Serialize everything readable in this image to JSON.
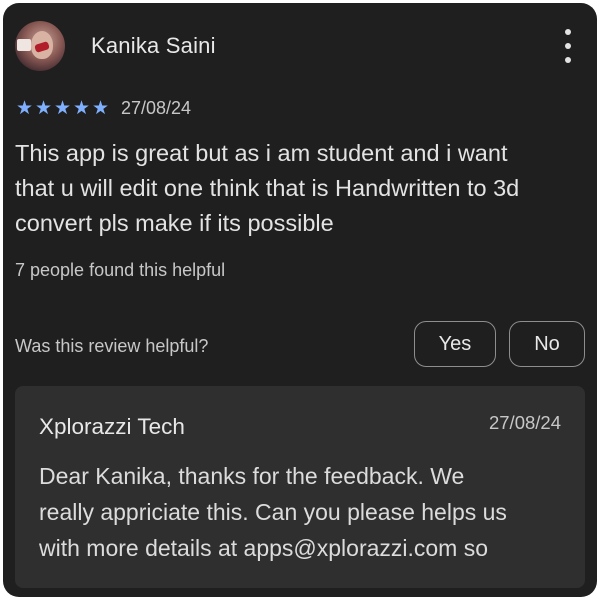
{
  "review": {
    "reviewer_name": "Kanika Saini",
    "avatar_icon": "user-avatar-photo",
    "more_icon": "more-vert-icon",
    "rating": 5,
    "rating_max": 5,
    "star_color": "#7fb0ff",
    "date": "27/08/24",
    "text_lines": [
      "This app is great but as i am student and i want",
      "that u will edit one think that is Handwritten to 3d",
      "convert pls make if its possible"
    ],
    "helpful_count_text": "7 people found this helpful"
  },
  "feedback": {
    "question": "Was this review helpful?",
    "yes_label": "Yes",
    "no_label": "No"
  },
  "developer_reply": {
    "developer_name": "Xplorazzi Tech",
    "date": "27/08/24",
    "text_lines": [
      "Dear Kanika, thanks for the feedback. We",
      "really appriciate this. Can you please helps us",
      "with more details at apps@xplorazzi.com so"
    ]
  },
  "colors": {
    "card_background": "#1f1f1f",
    "reply_background": "#2f2f2f",
    "button_border": "#8e8e8e"
  }
}
